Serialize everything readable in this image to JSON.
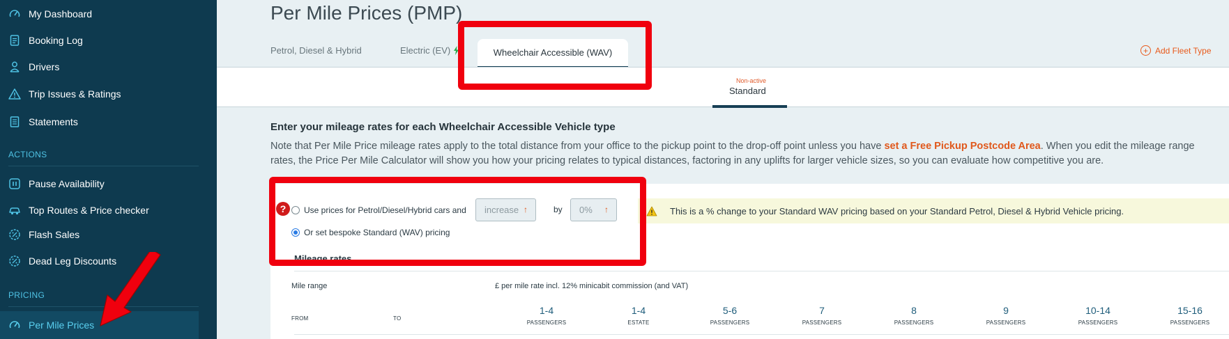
{
  "sidebar": {
    "items": [
      {
        "label": "My Dashboard",
        "icon": "speedometer-icon"
      },
      {
        "label": "Booking Log",
        "icon": "document-list-icon"
      },
      {
        "label": "Drivers",
        "icon": "driver-icon"
      },
      {
        "label": "Trip Issues & Ratings",
        "icon": "warning-triangle-icon"
      },
      {
        "label": "Statements",
        "icon": "statement-icon"
      }
    ],
    "actions_heading": "ACTIONS",
    "actions": [
      {
        "label": "Pause Availability",
        "icon": "pause-icon"
      },
      {
        "label": "Top Routes & Price checker",
        "icon": "car-icon"
      },
      {
        "label": "Flash Sales",
        "icon": "percent-badge-icon"
      },
      {
        "label": "Dead Leg Discounts",
        "icon": "percent-badge-icon"
      }
    ],
    "pricing_heading": "PRICING",
    "pricing": [
      {
        "label": "Per Mile Prices",
        "icon": "speedometer-icon",
        "active": true
      }
    ]
  },
  "header": {
    "title": "Per Mile Prices (PMP)",
    "tabs": [
      {
        "label": "Petrol, Diesel & Hybrid"
      },
      {
        "label": "Electric (EV)"
      },
      {
        "label": "Wheelchair Accessible (WAV)",
        "active": true
      }
    ],
    "add_fleet_label": "Add Fleet Type"
  },
  "subtab": {
    "status": "Non-active",
    "label": "Standard"
  },
  "intro": {
    "heading": "Enter your mileage rates for each Wheelchair Accessible Vehicle type",
    "line1_a": "Note that Per Mile Price mileage rates apply to the total distance from your office to the pickup point to the drop-off point unless you have ",
    "line1_link": "set a Free Pickup Postcode Area",
    "line1_b": ". When you edit the mileage range",
    "line2": "rates, the Price Per Mile Calculator will show you how your pricing relates to typical distances, factoring in any uplifts for larger vehicle sizes, so you can evaluate how competitive you are."
  },
  "pricing_options": {
    "help_glyph": "?",
    "option1_label": "Use prices for Petrol/Diesel/Hybrid cars and",
    "direction_value": "increase",
    "by_label": "by",
    "percent_value": "0%",
    "option2_label": "Or set bespoke Standard (WAV) pricing",
    "selected_option": 2,
    "warning_text": "This is a % change to your Standard WAV pricing based on your Standard Petrol, Diesel & Hybrid Vehicle pricing."
  },
  "mileage": {
    "title": "Mileage rates",
    "mile_range_label": "Mile range",
    "rate_label": "£ per mile rate incl. 12% minicabit commission (and VAT)",
    "from_label": "FROM",
    "to_label": "TO",
    "columns": [
      {
        "num": "1-4",
        "label": "PASSENGERS"
      },
      {
        "num": "1-4",
        "label": "ESTATE"
      },
      {
        "num": "5-6",
        "label": "PASSENGERS"
      },
      {
        "num": "7",
        "label": "PASSENGERS"
      },
      {
        "num": "8",
        "label": "PASSENGERS"
      },
      {
        "num": "9",
        "label": "PASSENGERS"
      },
      {
        "num": "10-14",
        "label": "PASSENGERS"
      },
      {
        "num": "15-16",
        "label": "PASSENGERS"
      }
    ]
  },
  "colors": {
    "sidebar_bg": "#0e3a4f",
    "sidebar_accent": "#4fc2e4",
    "link_orange": "#e0581c",
    "annotation_red": "#f0000e"
  }
}
